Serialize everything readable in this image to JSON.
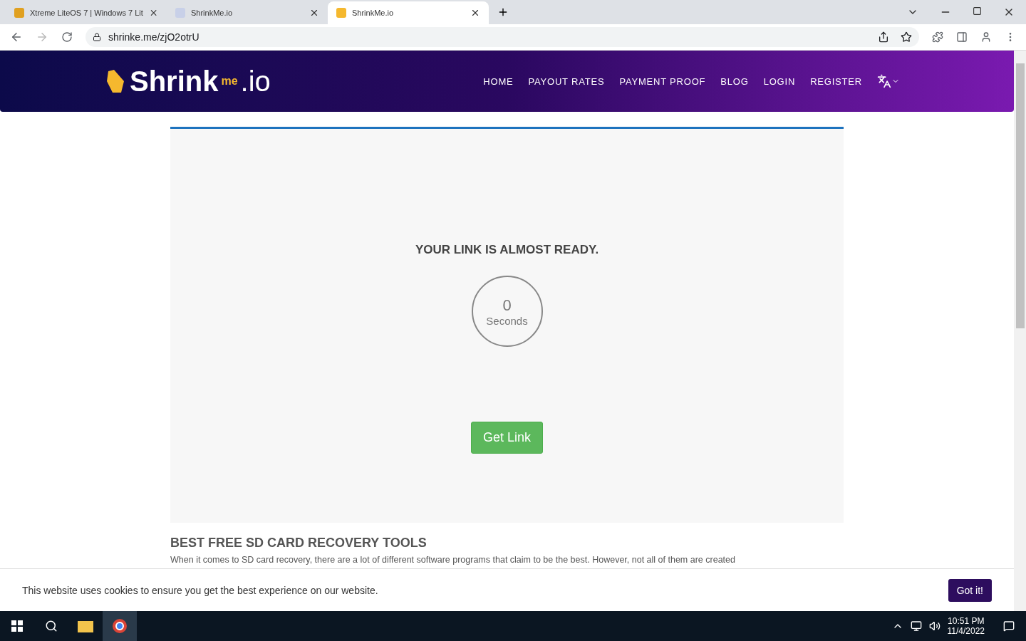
{
  "browser": {
    "tabs": [
      {
        "title": "Xtreme LiteOS 7 | Windows 7 Lit",
        "selected": false
      },
      {
        "title": "ShrinkMe.io",
        "selected": false
      },
      {
        "title": "ShrinkMe.io",
        "selected": true
      }
    ],
    "address": "shrinke.me/zjO2otrU"
  },
  "header": {
    "logo": {
      "main": "Shrink",
      "sub": "me",
      "tld": ".io"
    },
    "nav": [
      "HOME",
      "PAYOUT RATES",
      "PAYMENT PROOF",
      "BLOG",
      "LOGIN",
      "REGISTER"
    ]
  },
  "card": {
    "heading": "YOUR LINK IS ALMOST READY.",
    "countdown": "0",
    "unit": "Seconds",
    "button": "Get Link"
  },
  "article": {
    "heading": "BEST FREE SD CARD RECOVERY TOOLS",
    "text": "When it comes to SD card recovery, there are a lot of different software programs that claim to be the best. However, not all of them are created"
  },
  "cookie": {
    "text": "This website uses cookies to ensure you get the best experience on our website.",
    "button": "Got it!"
  },
  "taskbar": {
    "time": "10:51 PM",
    "date": "11/4/2022"
  }
}
